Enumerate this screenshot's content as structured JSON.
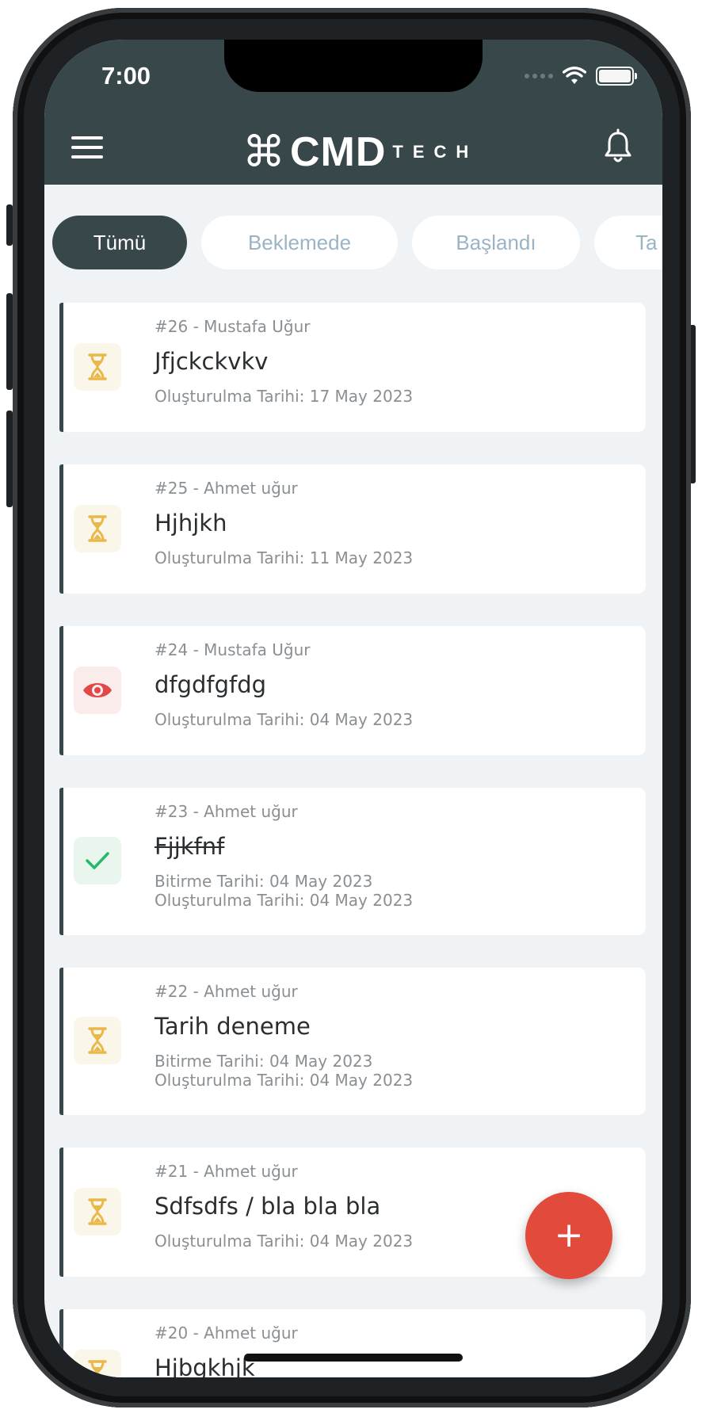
{
  "status_bar": {
    "time": "7:00"
  },
  "header": {
    "logo_main": "CMD",
    "logo_sub": "TECH",
    "logo_symbol": "⌘",
    "menu_icon": "hamburger-icon",
    "notification_icon": "bell-icon"
  },
  "tabs": [
    {
      "label": "Tümü",
      "active": true
    },
    {
      "label": "Beklemede",
      "active": false
    },
    {
      "label": "Başlandı",
      "active": false
    },
    {
      "label": "Ta",
      "active": false
    }
  ],
  "tasks": [
    {
      "meta": "#26 - Mustafa Uğur",
      "title": "Jfjckckvkv",
      "dates": [
        "Oluşturulma Tarihi: 17 May 2023"
      ],
      "status": "waiting",
      "icon": "hourglass-icon"
    },
    {
      "meta": "#25 - Ahmet uğur",
      "title": "Hjhjkh",
      "dates": [
        "Oluşturulma Tarihi: 11 May 2023"
      ],
      "status": "waiting",
      "icon": "hourglass-icon"
    },
    {
      "meta": "#24 - Mustafa Uğur",
      "title": "dfgdfgfdg",
      "dates": [
        "Oluşturulma Tarihi: 04 May 2023"
      ],
      "status": "review",
      "icon": "eye-icon"
    },
    {
      "meta": "#23 - Ahmet uğur",
      "title": "Fjjkfnf",
      "dates": [
        "Bitirme Tarihi: 04 May 2023",
        "Oluşturulma Tarihi: 04 May 2023"
      ],
      "status": "done",
      "icon": "checkmark-icon"
    },
    {
      "meta": "#22 - Ahmet uğur",
      "title": "Tarih deneme",
      "dates": [
        "Bitirme Tarihi: 04 May 2023",
        "Oluşturulma Tarihi: 04 May 2023"
      ],
      "status": "waiting",
      "icon": "hourglass-icon"
    },
    {
      "meta": "#21 - Ahmet uğur",
      "title": "Sdfsdfs / bla bla bla",
      "dates": [
        "Oluşturulma Tarihi: 04 May 2023"
      ],
      "status": "waiting",
      "icon": "hourglass-icon"
    },
    {
      "meta": "#20 - Ahmet uğur",
      "title": "Hjbgkhjk",
      "dates": [],
      "status": "waiting",
      "icon": "hourglass-icon"
    }
  ],
  "fab": {
    "label": "+",
    "icon": "plus-icon"
  },
  "colors": {
    "header_bg": "#37474a",
    "accent_red": "#e24a3b",
    "waiting_icon": "#e8b94a",
    "waiting_bg": "#fbf6ea",
    "review_icon": "#e0484a",
    "review_bg": "#fbecec",
    "done_icon": "#27b86a",
    "done_bg": "#e8f6ee"
  }
}
